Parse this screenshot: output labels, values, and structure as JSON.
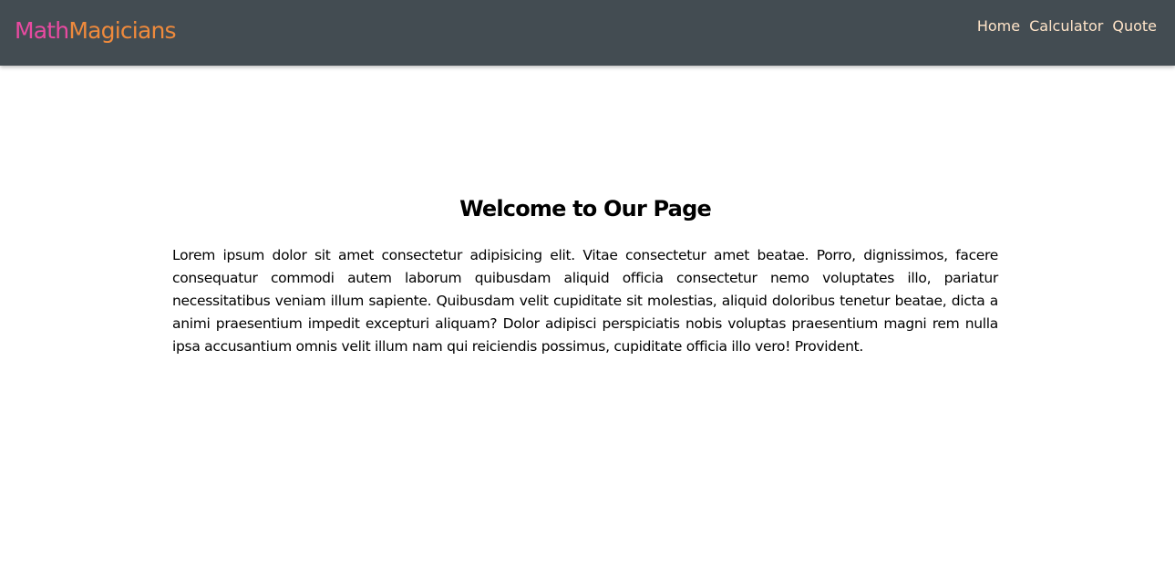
{
  "header": {
    "logo": {
      "part1": "Math",
      "part2": "Magicians",
      "colors": {
        "part1": "#e94aa1",
        "part2": "#ef8a3c"
      }
    },
    "nav": {
      "home": "Home",
      "calculator": "Calculator",
      "quote": "Quote"
    },
    "background": "#434c52",
    "link_color": "#ffe4c8"
  },
  "main": {
    "title": "Welcome to Our Page",
    "paragraph": "Lorem ipsum dolor sit amet consectetur adipisicing elit. Vitae consectetur amet beatae. Porro, dignissimos, facere consequatur commodi autem laborum quibusdam aliquid officia consectetur nemo voluptates illo, pariatur necessitatibus veniam illum sapiente. Quibusdam velit cupiditate sit molestias, aliquid doloribus tenetur beatae, dicta a animi praesentium impedit excepturi aliquam? Dolor adipisci perspiciatis nobis voluptas praesentium magni rem nulla ipsa accusantium omnis velit illum nam qui reiciendis possimus, cupiditate officia illo vero! Provident."
  }
}
